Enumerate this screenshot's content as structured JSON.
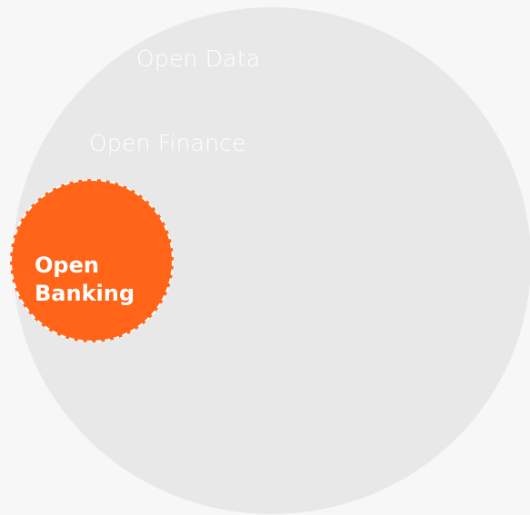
{
  "diagram": {
    "outer": {
      "label": "Open Data"
    },
    "middle": {
      "label": "Open Finance"
    },
    "inner": {
      "label": "Open Banking",
      "label_lines": [
        "Open",
        "Banking"
      ]
    }
  },
  "colors": {
    "background": "#f7f7f7",
    "open_data_fill": "#e8e8e8",
    "open_data_text": "#ffffff",
    "open_finance_text": "#ffffff",
    "open_banking_fill": "#ff6418",
    "open_banking_border": "#ffffff",
    "open_banking_text": "#ffffff"
  }
}
